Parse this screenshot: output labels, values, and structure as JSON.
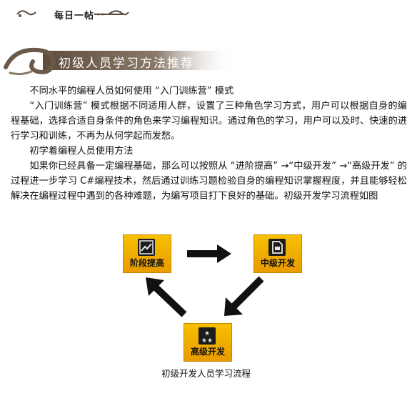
{
  "header": {
    "title": "每日一帖"
  },
  "section": {
    "title": "初级人员学习方法推荐"
  },
  "paragraphs": [
    "不同水平的编程人员如何使用 “入门训练营” 模式",
    "“入门训练营” 模式根据不同适用人群，设置了三种角色学习方式，用户可以根据自身的编程基础，选择合适自身条件的角色来学习编程知识。通过角色的学习，用户可以及时、快速的进行学习和训练，不再为从何学起而发愁。",
    "初学着编程人员使用方法",
    "如果你已经具备一定编程基础，那么可以按照从 “进阶提高” →“中级开发” →“高级开发” 的过程进一步学习 C#编程技术，然后通过训练习题检验自身的编程知识掌握程度，并且能够轻松解决在编程过程中遇到的各种难题，为编写项目打下良好的基础。初级开发学习流程如图"
  ],
  "diagram": {
    "nodes": [
      {
        "label": "阶段提高",
        "icon": "chart-icon"
      },
      {
        "label": "中级开发",
        "icon": "document-icon"
      },
      {
        "label": "高级开发",
        "icon": "stars-icon"
      }
    ],
    "caption": "初级开发人员学习流程"
  },
  "colors": {
    "tile_gold": "#f2b200",
    "arrow": "#111111",
    "swirl_brown": "#6b5a4a"
  }
}
